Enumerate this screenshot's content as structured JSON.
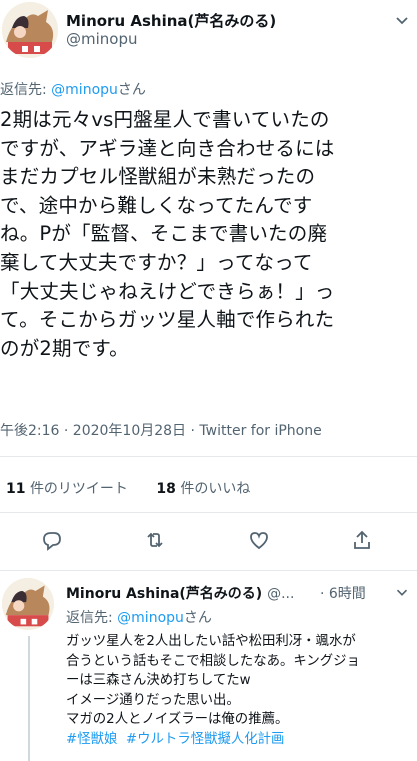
{
  "tweet": {
    "author_name": "Minoru Ashina(芦名みのる)",
    "author_handle": "@minopu",
    "replying_prefix": "返信先: ",
    "replying_handle": "@minopu",
    "replying_suffix": "さん",
    "text_lines": [
      "2期は元々vs円盤星人で書いていたの",
      "ですが、アギラ達と向き合わせるには",
      "まだカプセル怪獣組が未熟だったの",
      "で、途中から難しくなってたんです",
      "ね。Pが「監督、そこまで書いたの廃",
      "棄して大丈夫ですか？」ってなって",
      "「大丈夫じゃねえけどできらぁ！」っ",
      "て。そこからガッツ星人軸で作られた",
      "のが2期です。"
    ],
    "timestamp": "午後2:16 · 2020年10月28日 · Twitter for iPhone",
    "retweets_count": "11",
    "retweets_label": "件のリツイート",
    "likes_count": "18",
    "likes_label": "件のいいね"
  },
  "actions": {
    "icons": [
      "reply-icon",
      "retweet-icon",
      "like-icon",
      "share-icon"
    ]
  },
  "reply": {
    "author_name": "Minoru Ashina(芦名みのる)",
    "author_handle": "@...",
    "time": "· 6時間",
    "replying_prefix": "返信先: ",
    "replying_handle": "@minopu",
    "replying_suffix": "さん",
    "text_lines": [
      "ガッツ星人を2人出したい話や松田利冴・颯水が",
      "合うという話もそこで相談したなあ。キングジョ",
      "ーは三森さん決め打ちしてたw",
      "イメージ通りだった思い出。",
      "マガの2人とノイズラーは俺の推薦。"
    ],
    "hashtags": [
      "#怪獣娘",
      "#ウルトラ怪獣擬人化計画"
    ]
  },
  "colors": {
    "link": "#1d9bf0",
    "secondary": "#536471",
    "primary": "#0f1419"
  }
}
